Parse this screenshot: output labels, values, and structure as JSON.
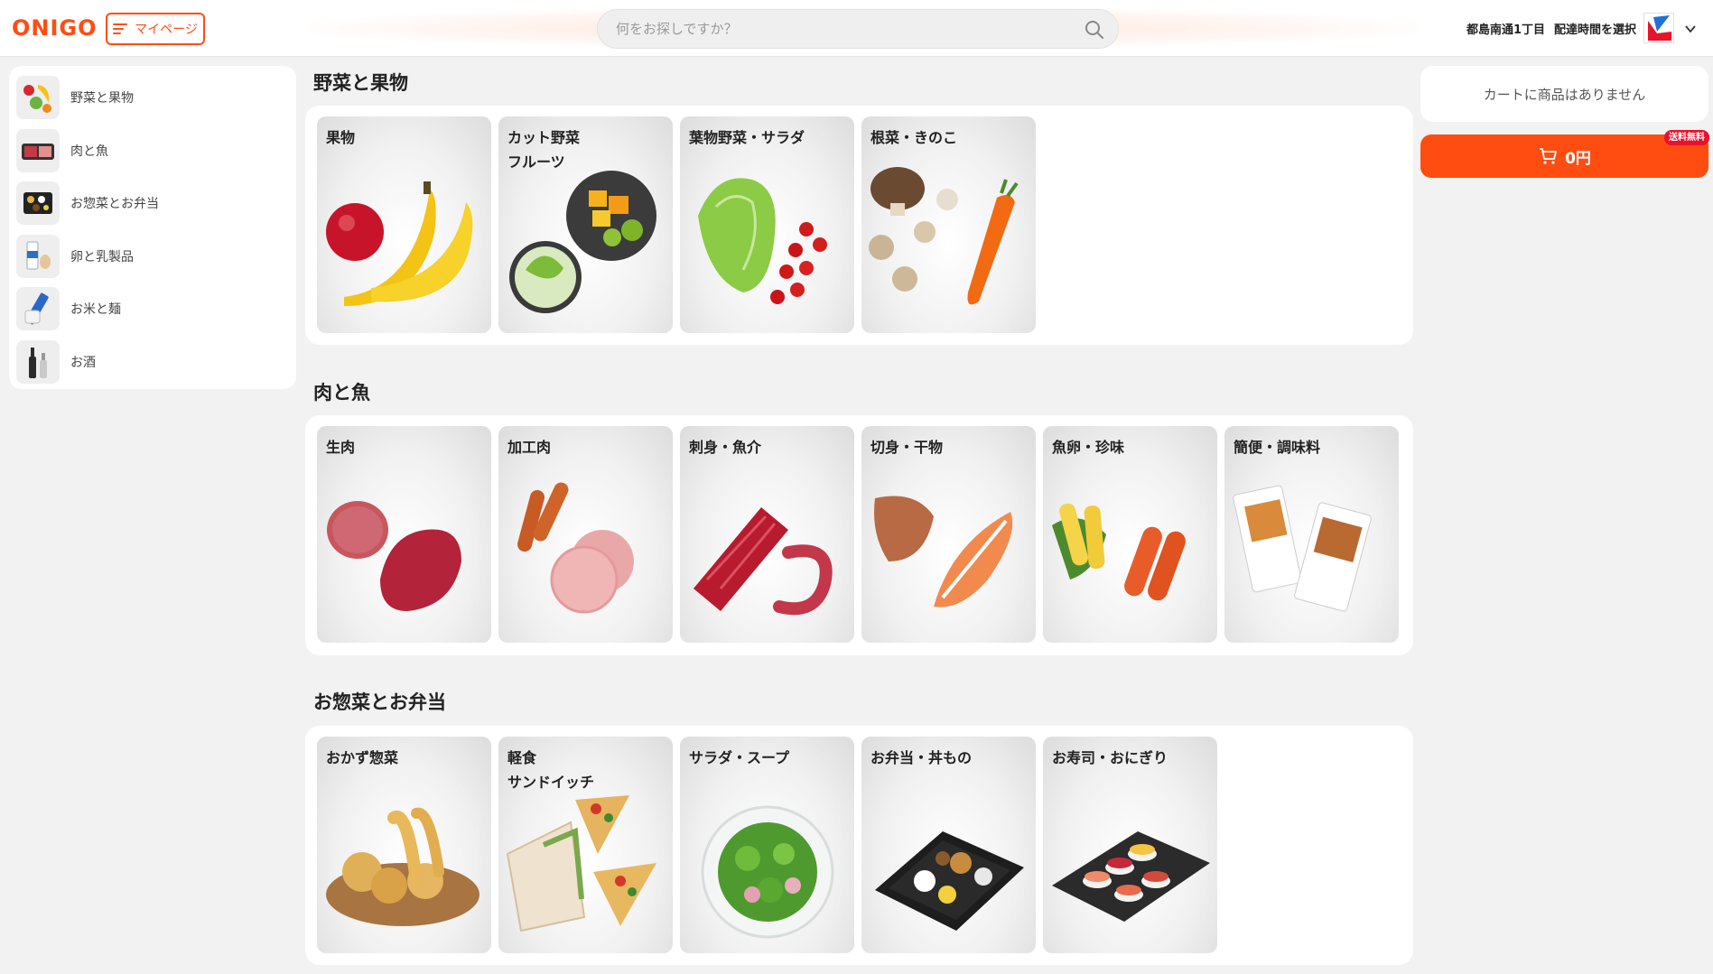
{
  "brand": {
    "logo": "ONIGO",
    "accent": "#ff4d12"
  },
  "header": {
    "mypage_label": "マイページ",
    "search_placeholder": "何をお探しですか？",
    "address": "都島南通1丁目",
    "delivery_time": "配達時間を選択"
  },
  "sidebar": {
    "items": [
      {
        "label": "野菜と果物",
        "icon": "vegetables-fruits-icon"
      },
      {
        "label": "肉と魚",
        "icon": "meat-fish-icon"
      },
      {
        "label": "お惣菜とお弁当",
        "icon": "deli-bento-icon"
      },
      {
        "label": "卵と乳製品",
        "icon": "eggs-dairy-icon"
      },
      {
        "label": "お米と麺",
        "icon": "rice-noodles-icon"
      },
      {
        "label": "お酒",
        "icon": "alcohol-icon"
      }
    ]
  },
  "sections": [
    {
      "title": "野菜と果物",
      "cards": [
        {
          "label": "果物",
          "art": "fruit"
        },
        {
          "label": "カット野菜\nフルーツ",
          "art": "cutveg"
        },
        {
          "label": "葉物野菜・サラダ",
          "art": "leafy"
        },
        {
          "label": "根菜・きのこ",
          "art": "root"
        }
      ]
    },
    {
      "title": "肉と魚",
      "cards": [
        {
          "label": "生肉",
          "art": "rawmeat"
        },
        {
          "label": "加工肉",
          "art": "processed"
        },
        {
          "label": "刺身・魚介",
          "art": "sashimi"
        },
        {
          "label": "切身・干物",
          "art": "fillet"
        },
        {
          "label": "魚卵・珍味",
          "art": "roe"
        },
        {
          "label": "簡便・調味料",
          "art": "packaged"
        }
      ]
    },
    {
      "title": "お惣菜とお弁当",
      "cards": [
        {
          "label": "おかず惣菜",
          "art": "tempura"
        },
        {
          "label": "軽食\nサンドイッチ",
          "art": "sandwich"
        },
        {
          "label": "サラダ・スープ",
          "art": "salad"
        },
        {
          "label": "お弁当・丼もの",
          "art": "bento"
        },
        {
          "label": "お寿司・おにぎり",
          "art": "sushi"
        }
      ]
    }
  ],
  "cart": {
    "empty_text": "カートに商品はありません",
    "total": "0円",
    "badge": "送料無料"
  }
}
